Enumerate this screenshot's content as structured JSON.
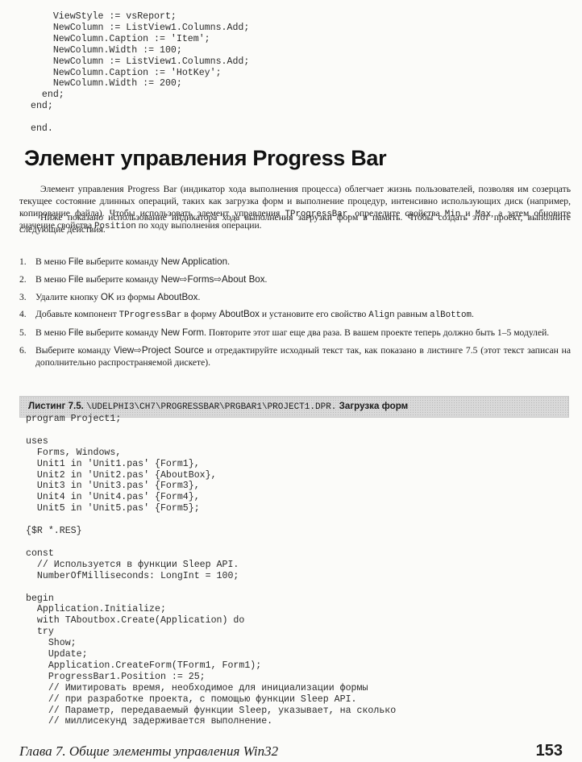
{
  "top_code": "    ViewStyle := vsReport;\n    NewColumn := ListView1.Columns.Add;\n    NewColumn.Caption := 'Item';\n    NewColumn.Width := 100;\n    NewColumn := ListView1.Columns.Add;\n    NewColumn.Caption := 'HotKey';\n    NewColumn.Width := 200;\n  end;\nend;\n\nend.",
  "heading": "Элемент управления Progress Bar",
  "para1": {
    "t1": "Элемент управления Progress Bar (индикатор хода выполнения процесса) облегчает жизнь пользователей, позволяя им созерцать текущее состояние длинных операций, таких как загрузка форм и выполнение процедур, интенсивно использующих диск (например, копирование файла). Чтобы использовать элемент управления ",
    "c1": "TProgressBar",
    "t2": ", определите свойства ",
    "c2": "Min",
    "t3": " и ",
    "c3": "Max",
    "t4": ", а затем обновите значение свойства ",
    "c4": "Position",
    "t5": " по ходу выполнения операции."
  },
  "para2": "Ниже показано использование индикатора хода выполнения загрузки форм в память. Чтобы создать этот проект, выполните следующие действия.",
  "steps": [
    {
      "num": "1.",
      "t1": "В меню ",
      "s1": "File",
      "t2": " выберите команду ",
      "s2": "New Application",
      "t3": "."
    },
    {
      "num": "2.",
      "t1": "В меню ",
      "s1": "File",
      "t2": " выберите команду ",
      "s2": "New⇨Forms⇨About Box",
      "t3": "."
    },
    {
      "num": "3.",
      "t1": "Удалите кнопку ",
      "s1": "OK",
      "t2": " из формы ",
      "s2": "AboutBox",
      "t3": "."
    },
    {
      "num": "4.",
      "t1": "Добавьте компонент ",
      "c1": "TProgressBar",
      "t2": " в форму ",
      "s1": "AboutBox",
      "t3": " и установите его свойство ",
      "c2": "Align",
      "t4": " равным ",
      "c3": "alBottom",
      "t5": "."
    },
    {
      "num": "5.",
      "t1": "В меню ",
      "s1": "File",
      "t2": " выберите команду ",
      "s2": "New Form",
      "t3": ". Повторите этот шаг еще два раза. В вашем проекте теперь должно быть 1–5 модулей."
    },
    {
      "num": "6.",
      "t1": "Выберите команду ",
      "s1": "View⇨Project Source",
      "t2": " и отредактируйте исходный текст так, как показано в листинге 7.5 (этот текст записан на дополнительно распространяемой дискете)."
    }
  ],
  "listing": {
    "label": "Листинг 7.5.",
    "path": "\\UDELPHI3\\CH7\\PROGRESSBAR\\PRGBAR1\\PROJECT1.DPR.",
    "caption": "Загрузка форм"
  },
  "listing_code": "program Project1;\n\nuses\n  Forms, Windows,\n  Unit1 in 'Unit1.pas' {Form1},\n  Unit2 in 'Unit2.pas' {AboutBox},\n  Unit3 in 'Unit3.pas' {Form3},\n  Unit4 in 'Unit4.pas' {Form4},\n  Unit5 in 'Unit5.pas' {Form5};\n\n{$R *.RES}\n\nconst\n  // Используется в функции Sleep API.\n  NumberOfMilliseconds: LongInt = 100;\n\nbegin\n  Application.Initialize;\n  with TAboutbox.Create(Application) do\n  try\n    Show;\n    Update;\n    Application.CreateForm(TForm1, Form1);\n    ProgressBar1.Position := 25;\n    // Имитировать время, необходимое для инициализации формы\n    // при разработке проекта, с помощью функции Sleep API.\n    // Параметр, передаваемый функции Sleep, указывает, на сколько\n    // миллисекунд задерживается выполнение.",
  "footer": {
    "chapter": "Глава 7. Общие элементы управления Win32",
    "page": "153"
  }
}
